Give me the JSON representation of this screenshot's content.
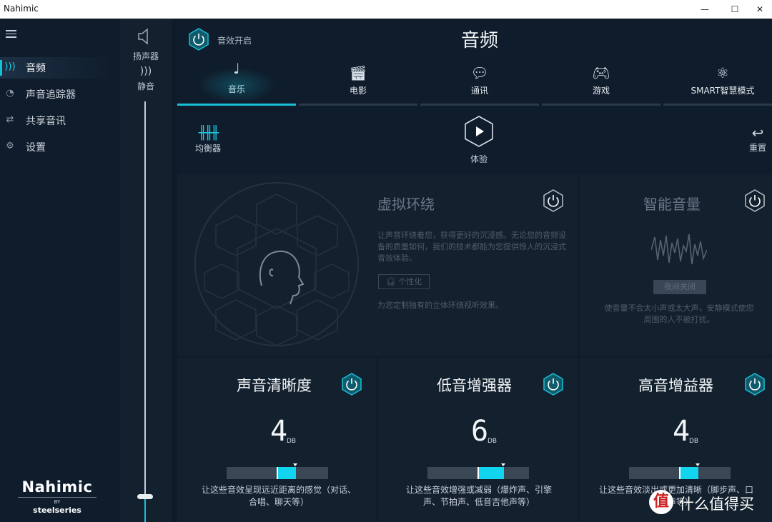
{
  "window": {
    "title": "Nahimic",
    "minimize": "—",
    "maximize": "☐",
    "close": "✕"
  },
  "sidebar": {
    "items": [
      {
        "label": "音频",
        "icon": "audio-icon"
      },
      {
        "label": "声音追踪器",
        "icon": "sound-tracker-icon"
      },
      {
        "label": "共享音讯",
        "icon": "share-audio-icon"
      },
      {
        "label": "设置",
        "icon": "gear-icon"
      }
    ],
    "active": "音频",
    "logo": {
      "name": "Nahimic",
      "by": "BY",
      "brand": "steelseries"
    }
  },
  "volume": {
    "speaker_label": "扬声器",
    "mute_label": "静音",
    "level": 0.0
  },
  "header": {
    "fx_label": "音效开启",
    "title": "音频"
  },
  "tabs": [
    {
      "label": "音乐",
      "icon": "music-note-icon",
      "active": true
    },
    {
      "label": "电影",
      "icon": "clapperboard-icon",
      "active": false
    },
    {
      "label": "通讯",
      "icon": "chat-bubbles-icon",
      "active": false
    },
    {
      "label": "游戏",
      "icon": "gamepad-icon",
      "active": false
    },
    {
      "label": "SMART智慧模式",
      "icon": "atom-icon",
      "active": false
    }
  ],
  "toolbar": {
    "equalizer_label": "均衡器",
    "play_label": "体验",
    "reset_label": "重置"
  },
  "surround": {
    "title": "虚拟环绕",
    "desc": "让声音环绕着您，获得更好的沉浸感。无论您的音频设备的质量如何，我们的技术都能为您提供惊人的沉浸式音效体验。",
    "personalize_label": "个性化",
    "footer": "为您定制独有的立体环绕视听效果。"
  },
  "smart_volume": {
    "title": "智能音量",
    "night_label": "夜间关闭",
    "desc": "使音量不会太小声或太大声，安静模式使您周围的人不被打扰。"
  },
  "controls": [
    {
      "title": "声音清晰度",
      "value": "4",
      "unit": "DB",
      "level": 0.5,
      "desc": "让这些音效呈现远近距离的感觉（对话、合唱、聊天等）"
    },
    {
      "title": "低音增强器",
      "value": "6",
      "unit": "DB",
      "level": 0.75,
      "desc": "让这些音效增强或减弱（爆炸声、引擎声、节拍声、低音吉他声等）"
    },
    {
      "title": "高音增益器",
      "value": "4",
      "unit": "DB",
      "level": 0.5,
      "desc": "让这些音效淡出或更加清晰（脚步声、口哨声等）"
    }
  ],
  "watermark": {
    "icon": "值",
    "text": "什么值得买"
  },
  "colors": {
    "accent": "#18c0d6",
    "background": "#0f1c2b",
    "panel": "#13202e"
  }
}
